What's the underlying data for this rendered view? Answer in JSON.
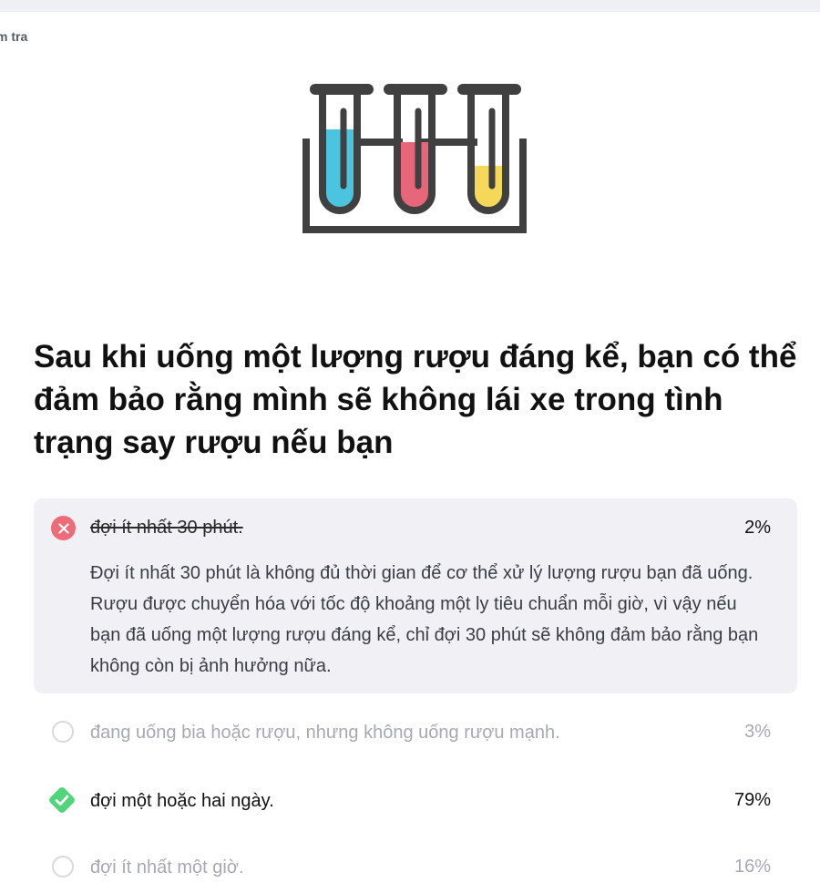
{
  "breadcrumb": "m tra",
  "question": "Sau khi uống một lượng rượu đáng kể, bạn có thể đảm bảo rằng mình sẽ không lái xe trong tình trạng say rượu nếu bạn",
  "illustration": {
    "icon": "test-tubes-icon",
    "colors": {
      "frame": "#404040",
      "tube1_liquid": "#4bc5df",
      "tube2_liquid": "#e8667a",
      "tube3_liquid": "#f5d75a"
    }
  },
  "answers": [
    {
      "text": "đợi ít nhất 30 phút.",
      "percent": "2%",
      "state": "wrong-selected",
      "explanation": "Đợi ít nhất 30 phút là không đủ thời gian để cơ thể xử lý lượng rượu bạn đã uống. Rượu được chuyển hóa với tốc độ khoảng một ly tiêu chuẩn mỗi giờ, vì vậy nếu bạn đã uống một lượng rượu đáng kể, chỉ đợi 30 phút sẽ không đảm bảo rằng bạn không còn bị ảnh hưởng nữa."
    },
    {
      "text": "đang uống bia hoặc rượu, nhưng không uống rượu mạnh.",
      "percent": "3%",
      "state": "unselected"
    },
    {
      "text": "đợi một hoặc hai ngày.",
      "percent": "79%",
      "state": "correct"
    },
    {
      "text": "đợi ít nhất một giờ.",
      "percent": "16%",
      "state": "unselected"
    }
  ],
  "colors": {
    "wrong": "#ee6b79",
    "correct": "#4fd67a",
    "card_bg": "#f1f1f5",
    "muted_text": "#a6a9b0"
  }
}
